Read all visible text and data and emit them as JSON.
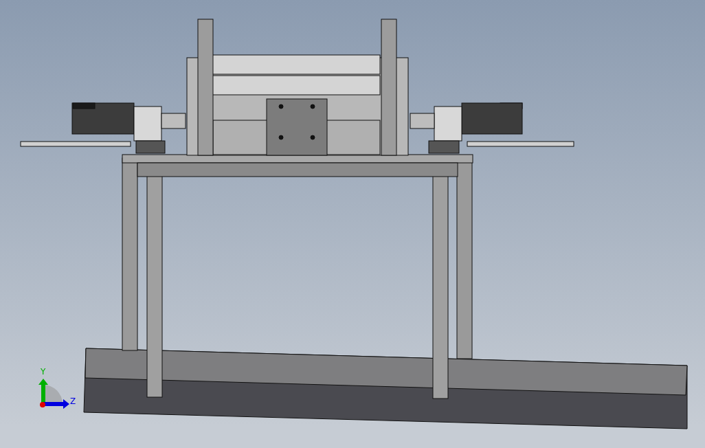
{
  "triad": {
    "axes": [
      {
        "label": "Y",
        "color": "#00b000"
      },
      {
        "label": "Z",
        "color": "#0000e0"
      }
    ]
  }
}
